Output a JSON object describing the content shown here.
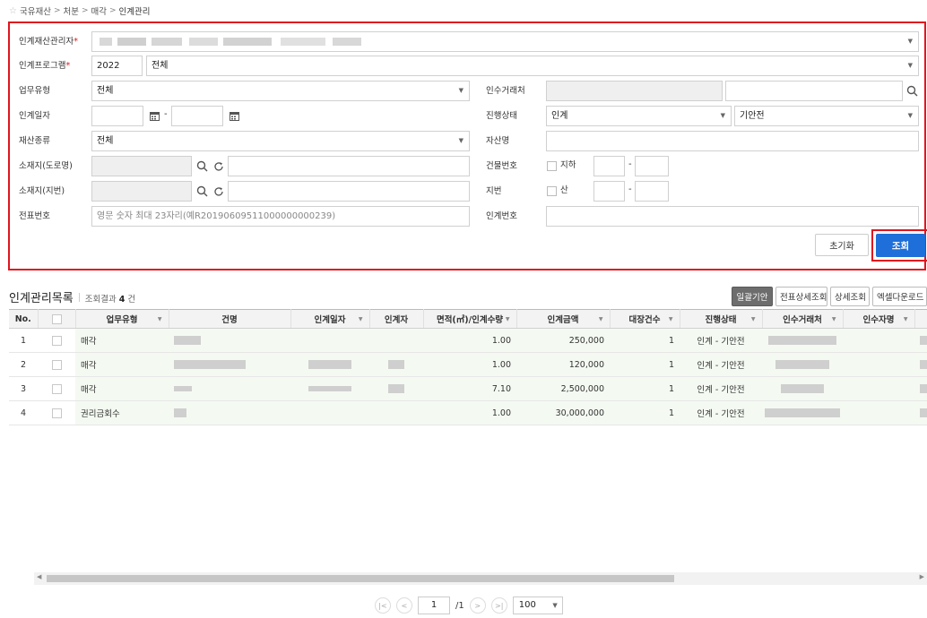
{
  "breadcrumb": [
    "국유재산",
    "처분",
    "매각",
    "인계관리"
  ],
  "search": {
    "manager_label": "인계재산관리자",
    "program_label": "인계프로그램",
    "program_year": "2022",
    "program_value": "전체",
    "work_type_label": "업무유형",
    "work_type_value": "전체",
    "receiver_label": "인수거래처",
    "date_label": "인계일자",
    "progress_label": "진행상태",
    "progress_value1": "인계",
    "progress_value2": "기안전",
    "asset_kind_label": "재산종류",
    "asset_kind_value": "전체",
    "asset_name_label": "자산명",
    "road_addr_label": "소재지(도로명)",
    "building_no_label": "건물번호",
    "basement_label": "지하",
    "lot_addr_label": "소재지(지번)",
    "lot_no_label": "지번",
    "mountain_label": "산",
    "voucher_label": "전표번호",
    "voucher_placeholder": "영문 숫자 최대 23자리(예R20190609511000000000239)",
    "handover_no_label": "인계번호",
    "reset_label": "초기화",
    "search_label": "조회"
  },
  "list": {
    "title": "인계관리목록",
    "count_prefix": "조회결과",
    "count": "4",
    "count_suffix": "건",
    "buttons": [
      "일괄기안",
      "전표상세조회",
      "상세조회",
      "엑셀다운로드"
    ]
  },
  "table": {
    "columns": [
      "No.",
      "",
      "업무유형",
      "건명",
      "인계일자",
      "인계자",
      "면적(㎡)/인계수량",
      "인계금액",
      "대장건수",
      "진행상태",
      "인수거래처",
      "인수자명"
    ],
    "rows": [
      {
        "no": "1",
        "type": "매각",
        "area": "1.00",
        "amount": "250,000",
        "count": "1",
        "status": "인계 - 기안전"
      },
      {
        "no": "2",
        "type": "매각",
        "area": "1.00",
        "amount": "120,000",
        "count": "1",
        "status": "인계 - 기안전"
      },
      {
        "no": "3",
        "type": "매각",
        "area": "7.10",
        "amount": "2,500,000",
        "count": "1",
        "status": "인계 - 기안전"
      },
      {
        "no": "4",
        "type": "권리금회수",
        "area": "1.00",
        "amount": "30,000,000",
        "count": "1",
        "status": "인계 - 기안전"
      }
    ]
  },
  "pager": {
    "page": "1",
    "total": "/1",
    "page_size": "100"
  },
  "icons": {
    "star": "star-icon",
    "search": "magnifier-icon",
    "refresh": "refresh-icon",
    "calendar": "calendar-icon"
  },
  "colors": {
    "highlight_border": "#e0151f",
    "primary": "#1e6fd9",
    "row_bg": "#f4faf2"
  }
}
